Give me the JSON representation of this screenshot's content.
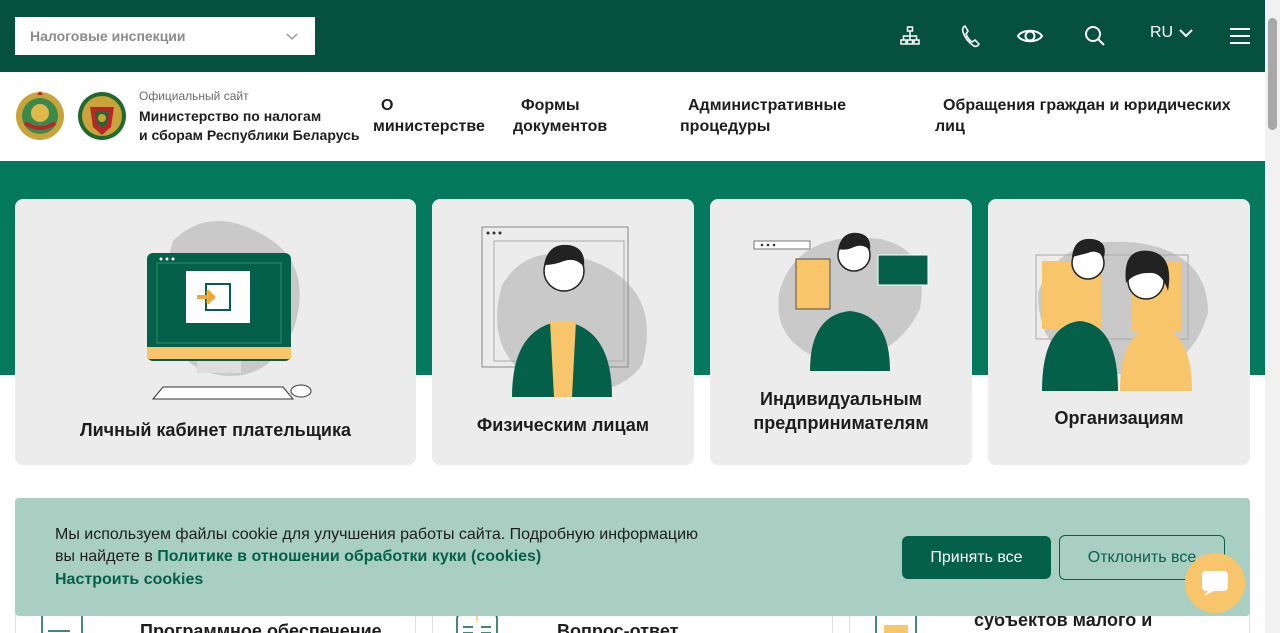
{
  "topbar": {
    "inspection_select": "Налоговые инспекции",
    "icons": [
      "sitemap-icon",
      "phone-icon",
      "eye-icon",
      "search-icon",
      "menu-icon"
    ],
    "lang": "RU"
  },
  "header": {
    "brand_small": "Официальный сайт",
    "brand_line1": "Министерство по налогам",
    "brand_line2": "и сборам Республики Беларусь",
    "nav": [
      {
        "line1": "О",
        "line2": "министерстве"
      },
      {
        "line1": "Формы",
        "line2": "документов"
      },
      {
        "line1": "Административные",
        "line2": "процедуры"
      },
      {
        "line1": "Обращения граждан и юридических",
        "line2": "лиц"
      }
    ]
  },
  "cards": [
    {
      "label": "Личный кабинет плательщика"
    },
    {
      "label": "Физическим лицам"
    },
    {
      "label_line1": "Индивидуальным",
      "label_line2": "предпринимателям"
    },
    {
      "label": "Организациям"
    }
  ],
  "lower_cards": [
    "Программное обеспечение",
    "Вопрос-ответ",
    "субъектов малого и"
  ],
  "cookie": {
    "text_line1": "Мы используем файлы cookie для улучшения работы сайта. Подробную информацию",
    "text_line2_prefix": "вы найдете в ",
    "policy_link": "Политике в отношении обработки куки (cookies)",
    "settings": "Настроить cookies",
    "accept": "Принять все",
    "decline": "Отклонить все"
  },
  "colors": {
    "topbar": "#05503f",
    "band": "#04795e",
    "accent_yellow": "#f9c56a",
    "green_dark": "#05604a"
  }
}
